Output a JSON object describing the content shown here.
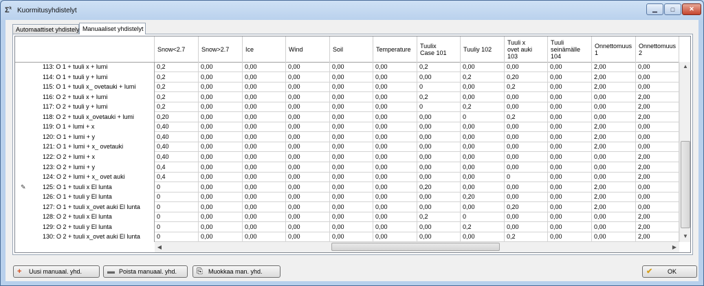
{
  "window": {
    "title": "Kuormitusyhdistelyt",
    "icon": "sigma-icon",
    "min": "minimize-icon",
    "max": "maximize-icon",
    "close": "close-icon"
  },
  "tabs": [
    {
      "label": "Automaattiset yhdistelyt",
      "active": false
    },
    {
      "label": "Manuaaliset yhdistelyt",
      "active": true
    }
  ],
  "grid": {
    "columns": [
      {
        "label": "Snow<2.7",
        "lines": [
          "Snow<2.7"
        ]
      },
      {
        "label": "Snow>2.7",
        "lines": [
          "Snow>2.7"
        ]
      },
      {
        "label": "Ice",
        "lines": [
          "Ice"
        ]
      },
      {
        "label": "Wind",
        "lines": [
          "Wind"
        ]
      },
      {
        "label": "Soil",
        "lines": [
          "Soil"
        ]
      },
      {
        "label": "Temperature",
        "lines": [
          "Temperature"
        ]
      },
      {
        "label": "Tuulix Case 101",
        "lines": [
          "Tuulix",
          "Case 101"
        ]
      },
      {
        "label": "Tuuliy 102",
        "lines": [
          "Tuuliy 102"
        ]
      },
      {
        "label": "Tuuli x ovet auki 103",
        "lines": [
          "Tuuli x",
          "ovet auki",
          "103"
        ]
      },
      {
        "label": "Tuuli seinämälle 104",
        "lines": [
          "Tuuli",
          "seinämälle",
          "104"
        ]
      },
      {
        "label": "Onnettomuus 1",
        "lines": [
          "Onnettomuus",
          "1"
        ]
      },
      {
        "label": "Onnettomuus 2",
        "lines": [
          "Onnettomuus",
          "2"
        ]
      }
    ],
    "rows": [
      {
        "label": "113: O 1 + tuuli x + lumi",
        "values": [
          "0,2",
          "0,00",
          "0,00",
          "0,00",
          "0,00",
          "0,00",
          "0,2",
          "0,00",
          "0,00",
          "0,00",
          "2,00",
          "0,00"
        ]
      },
      {
        "label": "114: O 1 + tuuli y + lumi",
        "values": [
          "0,2",
          "0,00",
          "0,00",
          "0,00",
          "0,00",
          "0,00",
          "0,00",
          "0,2",
          "0,20",
          "0,00",
          "2,00",
          "0,00"
        ]
      },
      {
        "label": "115: O 1 + tuuli x_ ovetauki + lumi",
        "values": [
          "0,2",
          "0,00",
          "0,00",
          "0,00",
          "0,00",
          "0,00",
          "0",
          "0,00",
          "0,2",
          "0,00",
          "2,00",
          "0,00"
        ]
      },
      {
        "label": "116: O 2 + tuuli x + lumi",
        "values": [
          "0,2",
          "0,00",
          "0,00",
          "0,00",
          "0,00",
          "0,00",
          "0,2",
          "0,00",
          "0,00",
          "0,00",
          "0,00",
          "2,00"
        ]
      },
      {
        "label": "117: O 2 + tuuli y + lumi",
        "values": [
          "0,2",
          "0,00",
          "0,00",
          "0,00",
          "0,00",
          "0,00",
          "0",
          "0,2",
          "0,00",
          "0,00",
          "0,00",
          "2,00"
        ]
      },
      {
        "label": "118: O 2 + tuuli x_ovetauki + lumi",
        "values": [
          "0,20",
          "0,00",
          "0,00",
          "0,00",
          "0,00",
          "0,00",
          "0,00",
          "0",
          "0,2",
          "0,00",
          "0,00",
          "2,00"
        ]
      },
      {
        "label": "119: O 1 + lumi + x",
        "values": [
          "0,40",
          "0,00",
          "0,00",
          "0,00",
          "0,00",
          "0,00",
          "0,00",
          "0,00",
          "0,00",
          "0,00",
          "2,00",
          "0,00"
        ]
      },
      {
        "label": "120: O 1 + lumi + y",
        "values": [
          "0,40",
          "0,00",
          "0,00",
          "0,00",
          "0,00",
          "0,00",
          "0,00",
          "0,00",
          "0,00",
          "0,00",
          "2,00",
          "0,00"
        ]
      },
      {
        "label": "121: O 1 + lumi  + x_ ovetauki",
        "values": [
          "0,40",
          "0,00",
          "0,00",
          "0,00",
          "0,00",
          "0,00",
          "0,00",
          "0,00",
          "0,00",
          "0,00",
          "2,00",
          "0,00"
        ]
      },
      {
        "label": "122: O 2 + lumi + x",
        "values": [
          "0,40",
          "0,00",
          "0,00",
          "0,00",
          "0,00",
          "0,00",
          "0,00",
          "0,00",
          "0,00",
          "0,00",
          "0,00",
          "2,00"
        ]
      },
      {
        "label": "123: O 2 + lumi + y",
        "values": [
          "0,4",
          "0,00",
          "0,00",
          "0,00",
          "0,00",
          "0,00",
          "0,00",
          "0,00",
          "0,00",
          "0,00",
          "0,00",
          "2,00"
        ]
      },
      {
        "label": "124: O 2 + lumi + x_ ovet auki",
        "values": [
          "0,4",
          "0,00",
          "0,00",
          "0,00",
          "0,00",
          "0,00",
          "0,00",
          "0,00",
          "0",
          "0,00",
          "0,00",
          "2,00"
        ]
      },
      {
        "label": "125: O 1 + tuuli x El lunta",
        "editing": true,
        "values": [
          "0",
          "0,00",
          "0,00",
          "0,00",
          "0,00",
          "0,00",
          "0,20",
          "0,00",
          "0,00",
          "0,00",
          "2,00",
          "0,00"
        ]
      },
      {
        "label": "126: O 1 + tuuli  y El lunta",
        "values": [
          "0",
          "0,00",
          "0,00",
          "0,00",
          "0,00",
          "0,00",
          "0,00",
          "0,20",
          "0,00",
          "0,00",
          "2,00",
          "0,00"
        ]
      },
      {
        "label": "127: O 1 + tuuli  x_ovet auki El lunta",
        "values": [
          "0",
          "0,00",
          "0,00",
          "0,00",
          "0,00",
          "0,00",
          "0,00",
          "0,00",
          "0,20",
          "0,00",
          "2,00",
          "0,00"
        ]
      },
      {
        "label": "128: O 2 + tuuli x El lunta",
        "values": [
          "0",
          "0,00",
          "0,00",
          "0,00",
          "0,00",
          "0,00",
          "0,2",
          "0",
          "0,00",
          "0,00",
          "0,00",
          "2,00"
        ]
      },
      {
        "label": "129: O 2 + tuuli  y El lunta",
        "values": [
          "0",
          "0,00",
          "0,00",
          "0,00",
          "0,00",
          "0,00",
          "0,00",
          "0,2",
          "0,00",
          "0,00",
          "0,00",
          "2,00"
        ]
      },
      {
        "label": "130: O 2 + tuuli  x_ovet auki El lunta",
        "values": [
          "0",
          "0,00",
          "0,00",
          "0,00",
          "0,00",
          "0,00",
          "0,00",
          "0,00",
          "0,2",
          "0,00",
          "0,00",
          "2,00"
        ]
      }
    ]
  },
  "buttons": {
    "new": {
      "label": "Uusi manuaal. yhd.",
      "icon": "plus-icon"
    },
    "delete": {
      "label": "Poista manuaal. yhd.",
      "icon": "minus-icon"
    },
    "edit": {
      "label": "Muokkaa man. yhd.",
      "icon": "edit-icon"
    },
    "ok": {
      "label": "OK",
      "icon": "checkmark-icon"
    }
  },
  "colors": {
    "titlebar": "#b8d0ec",
    "close": "#c5442e",
    "accent_plus": "#d24b1a",
    "accent_check": "#d6a020"
  }
}
